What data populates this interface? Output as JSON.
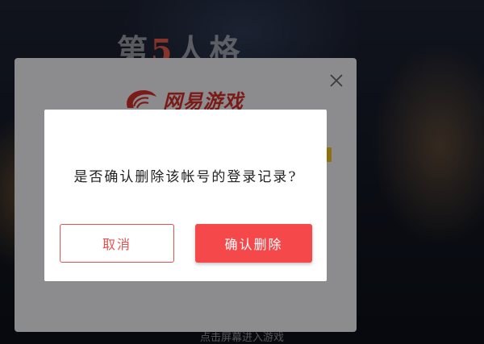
{
  "background": {
    "banner_prefix": "第",
    "banner_number": "5",
    "banner_suffix": "人格",
    "bottom_hint": "点击屏幕进入游戏"
  },
  "login_panel": {
    "logo_text": "网易游戏"
  },
  "confirm_dialog": {
    "message": "是否确认删除该帐号的登录记录?",
    "cancel_label": "取消",
    "confirm_label": "确认删除"
  },
  "colors": {
    "accent_red": "#f5484a",
    "cancel_border": "#e0544f",
    "logo_red": "#d2302a",
    "accent_yellow": "#f3c31c"
  },
  "icons": {
    "close": "close-icon",
    "logo": "netease-logo-icon"
  }
}
